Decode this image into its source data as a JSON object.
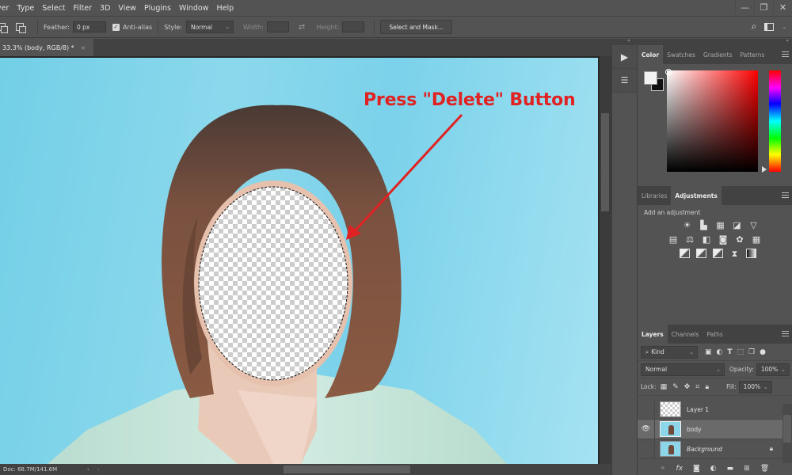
{
  "menubar": {
    "items": [
      "yer",
      "Type",
      "Select",
      "Filter",
      "3D",
      "View",
      "Plugins",
      "Window",
      "Help"
    ],
    "window_controls": [
      "minimize",
      "restore",
      "close"
    ]
  },
  "options_bar": {
    "feather_label": "Feather:",
    "feather_value": "0 px",
    "antialias_label": "Anti-alias",
    "antialias_checked": true,
    "style_label": "Style:",
    "style_value": "Normal",
    "width_label": "Width:",
    "height_label": "Height:",
    "select_mask_label": "Select and Mask...",
    "search_icon": "search-icon",
    "workspace_icon": "workspace-icon"
  },
  "document": {
    "tab_title": "33.3% (body, RGB/8) *",
    "close_label": "×",
    "status": "Doc: 68.7M/141.6M"
  },
  "annotation": {
    "text": "Press \"Delete\" Button",
    "color": "#e02222"
  },
  "color_panel": {
    "tabs": [
      "Color",
      "Swatches",
      "Gradients",
      "Patterns"
    ],
    "active_tab": "Color",
    "foreground": "#f2f2f2",
    "background": "#111111",
    "hue": "#ff0000"
  },
  "adjustments_panel": {
    "tabs": [
      "Libraries",
      "Adjustments"
    ],
    "active_tab": "Adjustments",
    "hint": "Add an adjustment",
    "rows": [
      [
        "brightness-contrast",
        "levels",
        "curves",
        "exposure",
        "vibrance"
      ],
      [
        "hue-saturation",
        "color-balance",
        "black-white",
        "photo-filter",
        "channel-mixer",
        "color-lookup"
      ],
      [
        "invert",
        "posterize",
        "threshold",
        "selective-color",
        "gradient-map"
      ]
    ]
  },
  "layers_panel": {
    "tabs": [
      "Layers",
      "Channels",
      "Paths"
    ],
    "active_tab": "Layers",
    "filter_label": "Kind",
    "blend_mode": "Normal",
    "opacity_label": "Opacity:",
    "opacity_value": "100%",
    "lock_label": "Lock:",
    "fill_label": "Fill:",
    "fill_value": "100%",
    "layers": [
      {
        "name": "Layer 1",
        "visible": false,
        "selected": false,
        "locked": false,
        "italic": false
      },
      {
        "name": "body",
        "visible": true,
        "selected": true,
        "locked": false,
        "italic": false
      },
      {
        "name": "Background",
        "visible": false,
        "selected": false,
        "locked": true,
        "italic": true
      }
    ]
  }
}
